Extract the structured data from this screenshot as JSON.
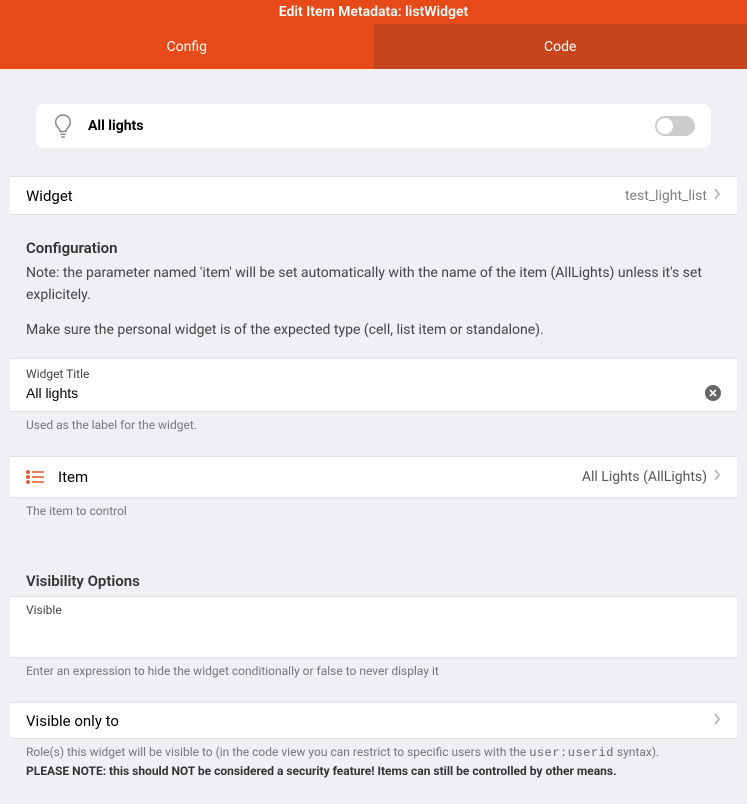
{
  "header": {
    "title": "Edit Item Metadata: listWidget",
    "tabs": {
      "config": "Config",
      "code": "Code"
    }
  },
  "preview": {
    "label": "All lights"
  },
  "widget_row": {
    "title": "Widget",
    "value": "test_light_list"
  },
  "config_section": {
    "header": "Configuration",
    "note1": "Note: the parameter named 'item' will be set automatically with the name of the item (AllLights) unless it's set explicitely.",
    "note2": "Make sure the personal widget is of the expected type (cell, list item or standalone)."
  },
  "widget_title_input": {
    "label": "Widget Title",
    "value": "All lights",
    "helper": "Used as the label for the widget."
  },
  "item_row": {
    "label": "Item",
    "value": "All Lights (AllLights)",
    "helper": "The item to control"
  },
  "visibility": {
    "header": "Visibility Options",
    "visible_label": "Visible",
    "visible_helper": "Enter an expression to hide the widget conditionally or false to never display it",
    "visible_only_label": "Visible only to",
    "roles_helper_prefix": "Role(s) this widget will be visible to (in the code view you can restrict to specific users with the ",
    "roles_helper_code": "user:userid",
    "roles_helper_suffix": " syntax).",
    "security_note": "PLEASE NOTE: this should NOT be considered a security feature! Items can still be controlled by other means."
  }
}
